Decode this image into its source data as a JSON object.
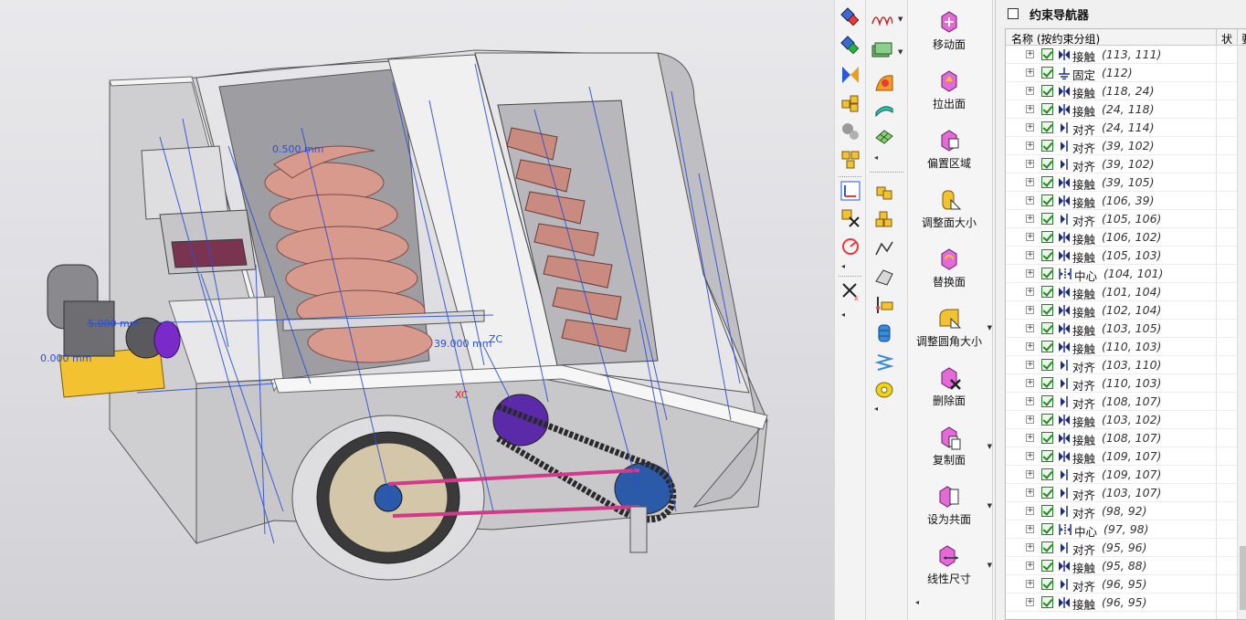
{
  "viewport": {
    "dimensions": [
      "0.500 mm",
      "39.000 mm",
      "0.000 mm",
      "5.000 mm"
    ],
    "axis_labels": [
      "ZC",
      "XC"
    ]
  },
  "colors": {
    "machine_body": "#d8d8d8",
    "augers": "#d99a8e",
    "constraint_lines": "#2a4fd6",
    "motor_base": "#f2c230",
    "coupling": "#7a2ac8",
    "chain": "#2a2a2a",
    "belt": "#d23b8c"
  },
  "toolbar_col1": {
    "icons": [
      "auto-constraint-icon",
      "constraint-icon",
      "mate-icon",
      "assembly-icon",
      "component-icon",
      "multi-component-icon",
      "coordinate-icon",
      "delete-constraint-icon",
      "rotate-icon",
      "remove-icon"
    ]
  },
  "toolbar_col2": {
    "icons": [
      "spring-icon",
      "money-icon",
      "surface-icon",
      "sheet-icon",
      "grid-icon",
      "cubes-icon",
      "cubes-stack-icon",
      "profile-icon",
      "bevel-icon",
      "measure-icon",
      "coil-icon",
      "spring-tall-icon",
      "roll-icon"
    ]
  },
  "commands": [
    {
      "label": "移动面",
      "icon": "move-face-icon",
      "has_dropdown": false
    },
    {
      "label": "拉出面",
      "icon": "pull-face-icon",
      "has_dropdown": false
    },
    {
      "label": "偏置区域",
      "icon": "offset-region-icon",
      "has_dropdown": false
    },
    {
      "label": "调整面大小",
      "icon": "resize-face-icon",
      "has_dropdown": false
    },
    {
      "label": "替换面",
      "icon": "replace-face-icon",
      "has_dropdown": false
    },
    {
      "label": "调整圆角大小",
      "icon": "resize-blend-icon",
      "has_dropdown": true
    },
    {
      "label": "删除面",
      "icon": "delete-face-icon",
      "has_dropdown": false
    },
    {
      "label": "复制面",
      "icon": "copy-face-icon",
      "has_dropdown": true
    },
    {
      "label": "设为共面",
      "icon": "make-coplanar-icon",
      "has_dropdown": true
    },
    {
      "label": "线性尺寸",
      "icon": "linear-dimension-icon",
      "has_dropdown": true
    }
  ],
  "navigator": {
    "title": "约束导航器",
    "columns": {
      "name": "名称 (按约束分组)",
      "status": "状",
      "extra": "要"
    },
    "rows": [
      {
        "type": "接触",
        "args": "(113, 111)",
        "kind": "touch"
      },
      {
        "type": "固定",
        "args": "(112)",
        "kind": "fix"
      },
      {
        "type": "接触",
        "args": "(118, 24)",
        "kind": "touch"
      },
      {
        "type": "接触",
        "args": "(24, 118)",
        "kind": "touch"
      },
      {
        "type": "对齐",
        "args": "(24, 114)",
        "kind": "align"
      },
      {
        "type": "对齐",
        "args": "(39, 102)",
        "kind": "align"
      },
      {
        "type": "对齐",
        "args": "(39, 102)",
        "kind": "align"
      },
      {
        "type": "接触",
        "args": "(39, 105)",
        "kind": "touch"
      },
      {
        "type": "接触",
        "args": "(106, 39)",
        "kind": "touch"
      },
      {
        "type": "对齐",
        "args": "(105, 106)",
        "kind": "align"
      },
      {
        "type": "接触",
        "args": "(106, 102)",
        "kind": "touch"
      },
      {
        "type": "接触",
        "args": "(105, 103)",
        "kind": "touch"
      },
      {
        "type": "中心",
        "args": "(104, 101)",
        "kind": "center"
      },
      {
        "type": "接触",
        "args": "(101, 104)",
        "kind": "touch"
      },
      {
        "type": "接触",
        "args": "(102, 104)",
        "kind": "touch"
      },
      {
        "type": "接触",
        "args": "(103, 105)",
        "kind": "touch"
      },
      {
        "type": "接触",
        "args": "(110, 103)",
        "kind": "touch"
      },
      {
        "type": "对齐",
        "args": "(103, 110)",
        "kind": "align"
      },
      {
        "type": "对齐",
        "args": "(110, 103)",
        "kind": "align"
      },
      {
        "type": "对齐",
        "args": "(108, 107)",
        "kind": "align"
      },
      {
        "type": "接触",
        "args": "(103, 102)",
        "kind": "touch"
      },
      {
        "type": "接触",
        "args": "(108, 107)",
        "kind": "touch"
      },
      {
        "type": "接触",
        "args": "(109, 107)",
        "kind": "touch"
      },
      {
        "type": "对齐",
        "args": "(109, 107)",
        "kind": "align"
      },
      {
        "type": "对齐",
        "args": "(103, 107)",
        "kind": "align"
      },
      {
        "type": "对齐",
        "args": "(98, 92)",
        "kind": "align"
      },
      {
        "type": "中心",
        "args": "(97, 98)",
        "kind": "center"
      },
      {
        "type": "对齐",
        "args": "(95, 96)",
        "kind": "align"
      },
      {
        "type": "接触",
        "args": "(95, 88)",
        "kind": "touch"
      },
      {
        "type": "对齐",
        "args": "(96, 95)",
        "kind": "align"
      },
      {
        "type": "接触",
        "args": "(96, 95)",
        "kind": "touch"
      }
    ]
  }
}
